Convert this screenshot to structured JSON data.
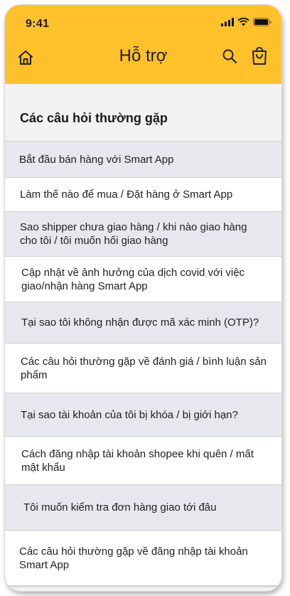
{
  "status_bar": {
    "time": "9:41"
  },
  "header": {
    "title": "Hỗ trợ"
  },
  "section": {
    "title": "Các câu hỏi thường gặp"
  },
  "faq": [
    "Bắt đầu bán hàng với Smart App",
    "Làm thế nào để mua / Đặt hàng ở Smart App",
    "Sao shipper chưa giao hàng / khi nào giao hàng cho tôi / tôi muốn hối giao hàng",
    "Cập nhật về ảnh hưởng của dịch covid với việc giao/nhận hàng Smart App",
    "Tại sao tôi không nhận được mã xác minh (OTP)?",
    "Các câu hỏi thường gặp về đánh giá / bình luận sản phẩm",
    "Tại sao tài khoản của tôi bị khóa / bị giới hạn?",
    "Cách đăng nhập tài khoản shopee khi quên / mất mật khẩu",
    "Tôi muốn kiểm tra đơn hàng giao tới đâu",
    "Các câu hỏi thường gặp về đăng nhập tài khoản Smart App"
  ],
  "colors": {
    "header_bg": "#fec12b",
    "row_grey": "#e7e8ed",
    "row_white": "#ffffff"
  },
  "icons": [
    "home-icon",
    "search-icon",
    "shopping-bag-icon",
    "signal-icon",
    "wifi-icon",
    "battery-icon"
  ]
}
